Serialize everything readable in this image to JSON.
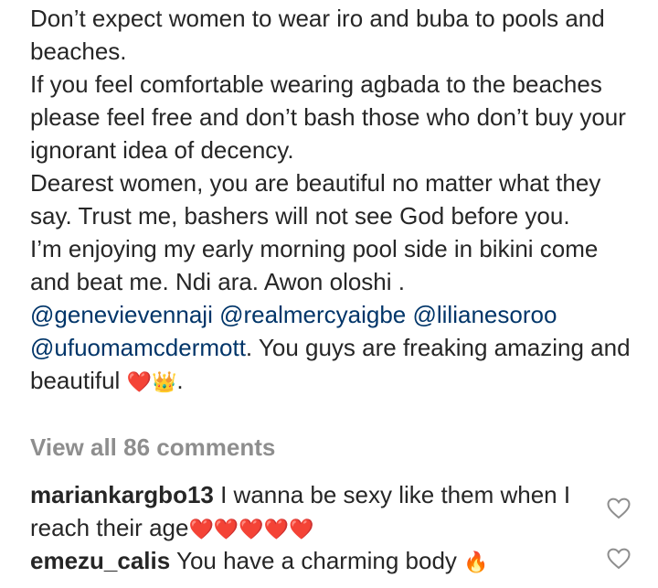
{
  "caption": {
    "lines": [
      "Don’t expect women to wear iro and buba to pools and beaches.",
      "If you feel comfortable wearing agbada to the beaches please feel free and don’t bash those who don’t buy your ignorant idea of decency.",
      "Dearest women, you are beautiful no matter what they say. Trust me, bashers will not see God before you.",
      "I’m enjoying my early morning pool side in bikini come and beat me. Ndi ara. Awon oloshi ."
    ],
    "mentions": [
      "@genevievennaji",
      "@realmercyaigbe",
      "@lilianesoroo",
      "@ufuomamcdermott"
    ],
    "closing_text": ". You guys are freaking amazing and beautiful",
    "closing_emojis": "❤️👑",
    "closing_end": "."
  },
  "view_all_comments": "View all 86 comments",
  "comments": [
    {
      "username": "mariankargbo13",
      "text": "I wanna be sexy like them when I reach their age",
      "emojis": "❤️❤️❤️❤️❤️",
      "like_icon": "heart-outline-icon"
    },
    {
      "username": "emezu_calis",
      "text": "You have a charming body",
      "emojis": "🔥",
      "like_icon": "heart-outline-icon"
    }
  ],
  "colors": {
    "text": "#262626",
    "mention": "#003569",
    "muted": "#8e8e8e"
  }
}
